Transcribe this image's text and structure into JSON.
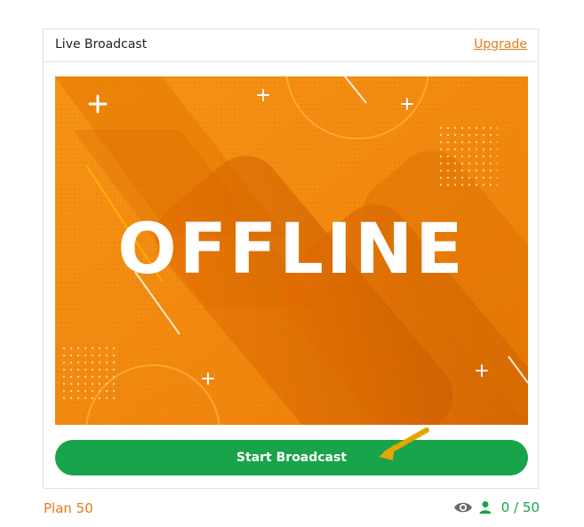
{
  "card": {
    "title": "Live Broadcast",
    "upgrade_label": "Upgrade"
  },
  "banner": {
    "status_text": "OFFLINE",
    "colors": {
      "base": "#f28a0d",
      "dark": "#c85a00",
      "text": "#ffffff"
    }
  },
  "actions": {
    "start_broadcast_label": "Start Broadcast"
  },
  "footer": {
    "plan_label": "Plan 50",
    "viewers": "0 / 50"
  },
  "colors": {
    "accent_orange": "#e87a1c",
    "accent_green": "#19a34a"
  },
  "icons": [
    "eye-icon",
    "user-icon",
    "arrow-icon"
  ]
}
